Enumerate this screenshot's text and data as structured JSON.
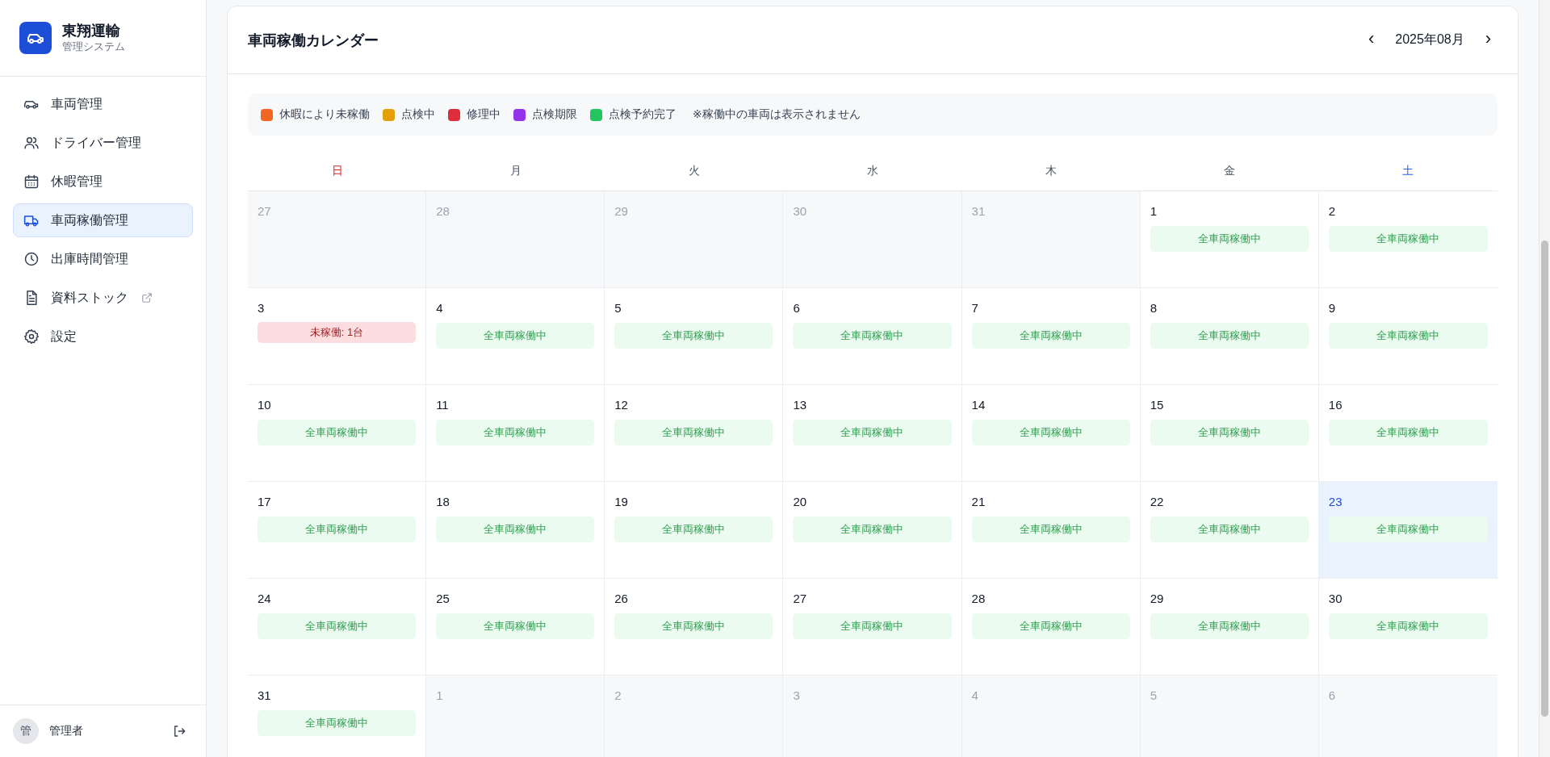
{
  "sidebar": {
    "brand": {
      "name": "東翔運輸",
      "subtitle": "管理システム"
    },
    "items": [
      {
        "label": "車両管理",
        "selected": false,
        "external": false
      },
      {
        "label": "ドライバー管理",
        "selected": false,
        "external": false
      },
      {
        "label": "休暇管理",
        "selected": false,
        "external": false
      },
      {
        "label": "車両稼働管理",
        "selected": true,
        "external": false
      },
      {
        "label": "出庫時間管理",
        "selected": false,
        "external": false
      },
      {
        "label": "資料ストック",
        "selected": false,
        "external": true
      },
      {
        "label": "設定",
        "selected": false,
        "external": false
      }
    ],
    "user": {
      "avatar": "管",
      "name": "管理者"
    }
  },
  "calendar": {
    "title": "車両稼働カレンダー",
    "month": "2025年08月",
    "prev": "‹",
    "next": "›",
    "legend": [
      {
        "label": "休暇により未稼働",
        "color": "#f26522"
      },
      {
        "label": "点検中",
        "color": "#e3a008"
      },
      {
        "label": "修理中",
        "color": "#e02d3c"
      },
      {
        "label": "点検期限",
        "color": "#9333ea"
      },
      {
        "label": "点検予約完了",
        "color": "#22c55e"
      }
    ],
    "note": "※稼働中の車両は表示されません",
    "weekdays": [
      {
        "label": "日",
        "kind": "sunday"
      },
      {
        "label": "月",
        "kind": "weekday"
      },
      {
        "label": "火",
        "kind": "weekday"
      },
      {
        "label": "水",
        "kind": "weekday"
      },
      {
        "label": "木",
        "kind": "weekday"
      },
      {
        "label": "金",
        "kind": "weekday"
      },
      {
        "label": "土",
        "kind": "saturday"
      }
    ],
    "days": [
      {
        "day": "27",
        "current_month": false,
        "today": false
      },
      {
        "day": "28",
        "current_month": false,
        "today": false
      },
      {
        "day": "29",
        "current_month": false,
        "today": false
      },
      {
        "day": "30",
        "current_month": false,
        "today": false
      },
      {
        "day": "31",
        "current_month": false,
        "today": false
      },
      {
        "day": "1",
        "current_month": true,
        "today": false,
        "status": {
          "kind": "ok",
          "text": "全車両稼働中"
        }
      },
      {
        "day": "2",
        "current_month": true,
        "today": false,
        "status": {
          "kind": "ok",
          "text": "全車両稼働中"
        }
      },
      {
        "day": "3",
        "current_month": true,
        "today": false,
        "status": {
          "kind": "idle",
          "text": "未稼働: 1台"
        }
      },
      {
        "day": "4",
        "current_month": true,
        "today": false,
        "status": {
          "kind": "ok",
          "text": "全車両稼働中"
        }
      },
      {
        "day": "5",
        "current_month": true,
        "today": false,
        "status": {
          "kind": "ok",
          "text": "全車両稼働中"
        }
      },
      {
        "day": "6",
        "current_month": true,
        "today": false,
        "status": {
          "kind": "ok",
          "text": "全車両稼働中"
        }
      },
      {
        "day": "7",
        "current_month": true,
        "today": false,
        "status": {
          "kind": "ok",
          "text": "全車両稼働中"
        }
      },
      {
        "day": "8",
        "current_month": true,
        "today": false,
        "status": {
          "kind": "ok",
          "text": "全車両稼働中"
        }
      },
      {
        "day": "9",
        "current_month": true,
        "today": false,
        "status": {
          "kind": "ok",
          "text": "全車両稼働中"
        }
      },
      {
        "day": "10",
        "current_month": true,
        "today": false,
        "status": {
          "kind": "ok",
          "text": "全車両稼働中"
        }
      },
      {
        "day": "11",
        "current_month": true,
        "today": false,
        "status": {
          "kind": "ok",
          "text": "全車両稼働中"
        }
      },
      {
        "day": "12",
        "current_month": true,
        "today": false,
        "status": {
          "kind": "ok",
          "text": "全車両稼働中"
        }
      },
      {
        "day": "13",
        "current_month": true,
        "today": false,
        "status": {
          "kind": "ok",
          "text": "全車両稼働中"
        }
      },
      {
        "day": "14",
        "current_month": true,
        "today": false,
        "status": {
          "kind": "ok",
          "text": "全車両稼働中"
        }
      },
      {
        "day": "15",
        "current_month": true,
        "today": false,
        "status": {
          "kind": "ok",
          "text": "全車両稼働中"
        }
      },
      {
        "day": "16",
        "current_month": true,
        "today": false,
        "status": {
          "kind": "ok",
          "text": "全車両稼働中"
        }
      },
      {
        "day": "17",
        "current_month": true,
        "today": false,
        "status": {
          "kind": "ok",
          "text": "全車両稼働中"
        }
      },
      {
        "day": "18",
        "current_month": true,
        "today": false,
        "status": {
          "kind": "ok",
          "text": "全車両稼働中"
        }
      },
      {
        "day": "19",
        "current_month": true,
        "today": false,
        "status": {
          "kind": "ok",
          "text": "全車両稼働中"
        }
      },
      {
        "day": "20",
        "current_month": true,
        "today": false,
        "status": {
          "kind": "ok",
          "text": "全車両稼働中"
        }
      },
      {
        "day": "21",
        "current_month": true,
        "today": false,
        "status": {
          "kind": "ok",
          "text": "全車両稼働中"
        }
      },
      {
        "day": "22",
        "current_month": true,
        "today": false,
        "status": {
          "kind": "ok",
          "text": "全車両稼働中"
        }
      },
      {
        "day": "23",
        "current_month": true,
        "today": true,
        "status": {
          "kind": "ok",
          "text": "全車両稼働中"
        }
      },
      {
        "day": "24",
        "current_month": true,
        "today": false,
        "status": {
          "kind": "ok",
          "text": "全車両稼働中"
        }
      },
      {
        "day": "25",
        "current_month": true,
        "today": false,
        "status": {
          "kind": "ok",
          "text": "全車両稼働中"
        }
      },
      {
        "day": "26",
        "current_month": true,
        "today": false,
        "status": {
          "kind": "ok",
          "text": "全車両稼働中"
        }
      },
      {
        "day": "27",
        "current_month": true,
        "today": false,
        "status": {
          "kind": "ok",
          "text": "全車両稼働中"
        }
      },
      {
        "day": "28",
        "current_month": true,
        "today": false,
        "status": {
          "kind": "ok",
          "text": "全車両稼働中"
        }
      },
      {
        "day": "29",
        "current_month": true,
        "today": false,
        "status": {
          "kind": "ok",
          "text": "全車両稼働中"
        }
      },
      {
        "day": "30",
        "current_month": true,
        "today": false,
        "status": {
          "kind": "ok",
          "text": "全車両稼働中"
        }
      },
      {
        "day": "31",
        "current_month": true,
        "today": false,
        "status": {
          "kind": "ok",
          "text": "全車両稼働中"
        }
      },
      {
        "day": "1",
        "current_month": false,
        "today": false
      },
      {
        "day": "2",
        "current_month": false,
        "today": false
      },
      {
        "day": "3",
        "current_month": false,
        "today": false
      },
      {
        "day": "4",
        "current_month": false,
        "today": false
      },
      {
        "day": "5",
        "current_month": false,
        "today": false
      },
      {
        "day": "6",
        "current_month": false,
        "today": false
      }
    ]
  }
}
